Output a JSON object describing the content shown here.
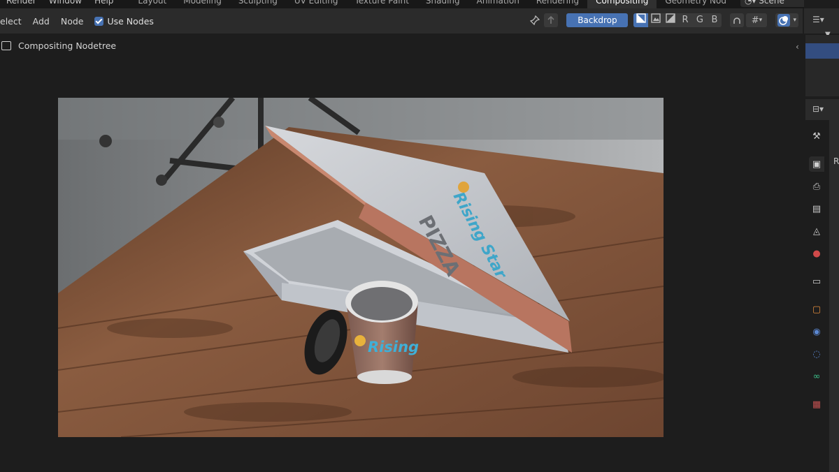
{
  "topbar": {
    "menus": [
      "Render",
      "Window",
      "Help"
    ],
    "workspaces": [
      "Layout",
      "Modeling",
      "Sculpting",
      "UV Editing",
      "Texture Paint",
      "Shading",
      "Animation",
      "Rendering",
      "Compositing",
      "Geometry Nod"
    ],
    "active_workspace": "Compositing",
    "scene": "Scene"
  },
  "header": {
    "menus": [
      "elect",
      "Add",
      "Node"
    ],
    "use_nodes_label": "Use Nodes",
    "use_nodes_checked": true,
    "backdrop_label": "Backdrop",
    "channels": [
      "R",
      "G",
      "B"
    ],
    "accent": "#4772b3"
  },
  "breadcrumb": {
    "label": "Compositing Nodetree"
  },
  "render": {
    "box_text_line1": "Rising Star",
    "box_text_line2": "PIZZA",
    "cup_text": "Rising"
  },
  "properties": {
    "visible_label": "R"
  }
}
